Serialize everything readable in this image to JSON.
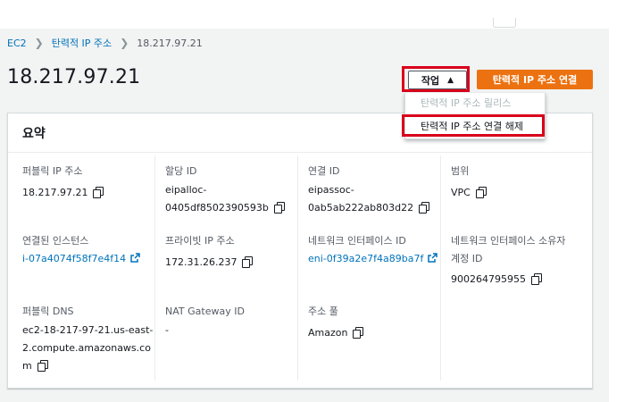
{
  "breadcrumb": {
    "ec2": "EC2",
    "eip": "탄력적 IP 주소",
    "current": "18.217.97.21",
    "sep_icon": "chevron-right-icon"
  },
  "page_title": "18.217.97.21",
  "header_actions": {
    "actions_label": "작업",
    "actions_icon": "caret-up-icon",
    "associate_label": "탄력적 IP 주소 연결",
    "associate_color": "#ec7211"
  },
  "actions_menu": {
    "release_label": "탄력적 IP 주소 릴리스",
    "disassociate_label": "탄력적 IP 주소 연결 해제"
  },
  "summary": {
    "title": "요약",
    "public_ip": {
      "label": "퍼블릭 IP 주소",
      "value": "18.217.97.21"
    },
    "allocation_id": {
      "label": "할당 ID",
      "value_1": "eipalloc-",
      "value_2": "0405df8502390593b"
    },
    "association_id": {
      "label": "연결 ID",
      "value_1": "eipassoc-",
      "value_2": "0ab5ab222ab803d22"
    },
    "scope": {
      "label": "범위",
      "value": "VPC"
    },
    "instance": {
      "label": "연결된 인스턴스",
      "value": "i-07a4074f58f7e4f14"
    },
    "private_ip": {
      "label": "프라이빗 IP 주소",
      "value": "172.31.26.237"
    },
    "eni": {
      "label": "네트워크 인터페이스 ID",
      "value": "eni-0f39a2e7f4a89ba7f"
    },
    "eni_owner": {
      "label_1": "네트워크 인터페이스 소유자",
      "label_2": "계정 ID",
      "value": "900264795955"
    },
    "public_dns": {
      "label": "퍼블릭 DNS",
      "value_1": "ec2-18-217-97-21.us-east-",
      "value_2": "2.compute.amazonaws.co",
      "value_3": "m"
    },
    "nat_gateway": {
      "label": "NAT Gateway ID",
      "value": "-"
    },
    "address_pool": {
      "label": "주소 풀",
      "value": "Amazon"
    }
  },
  "colors": {
    "link": "#0073bb",
    "highlight": "#d9001b",
    "text": "#16191f",
    "muted": "#545b64"
  }
}
